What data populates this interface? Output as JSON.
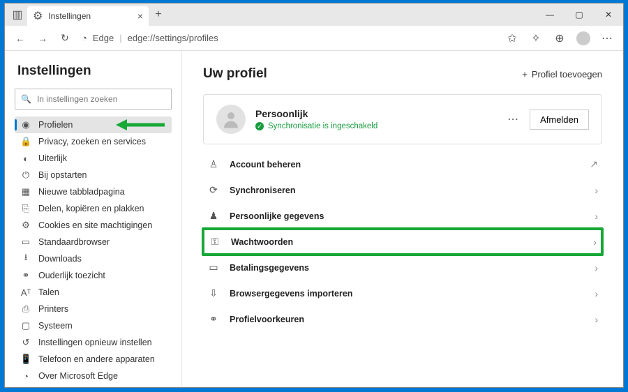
{
  "tab": {
    "title": "Instellingen"
  },
  "addressbar": {
    "brand": "Edge",
    "url": "edge://settings/profiles"
  },
  "sidebar": {
    "title": "Instellingen",
    "search_placeholder": "In instellingen zoeken",
    "items": [
      {
        "label": "Profielen"
      },
      {
        "label": "Privacy, zoeken en services"
      },
      {
        "label": "Uiterlijk"
      },
      {
        "label": "Bij opstarten"
      },
      {
        "label": "Nieuwe tabbladpagina"
      },
      {
        "label": "Delen, kopiëren en plakken"
      },
      {
        "label": "Cookies en site machtigingen"
      },
      {
        "label": "Standaardbrowser"
      },
      {
        "label": "Downloads"
      },
      {
        "label": "Ouderlijk toezicht"
      },
      {
        "label": "Talen"
      },
      {
        "label": "Printers"
      },
      {
        "label": "Systeem"
      },
      {
        "label": "Instellingen opnieuw instellen"
      },
      {
        "label": "Telefoon en andere apparaten"
      },
      {
        "label": "Over Microsoft Edge"
      }
    ]
  },
  "main": {
    "title": "Uw profiel",
    "add_profile": "Profiel toevoegen",
    "profile": {
      "name": "Persoonlijk",
      "sync_status": "Synchronisatie is ingeschakeld",
      "signout": "Afmelden"
    },
    "menu": [
      {
        "label": "Account beheren",
        "trail": "external"
      },
      {
        "label": "Synchroniseren",
        "trail": "chevron"
      },
      {
        "label": "Persoonlijke gegevens",
        "trail": "chevron"
      },
      {
        "label": "Wachtwoorden",
        "trail": "chevron",
        "highlight": true
      },
      {
        "label": "Betalingsgegevens",
        "trail": "chevron"
      },
      {
        "label": "Browsergegevens importeren",
        "trail": "chevron"
      },
      {
        "label": "Profielvoorkeuren",
        "trail": "chevron"
      }
    ]
  }
}
